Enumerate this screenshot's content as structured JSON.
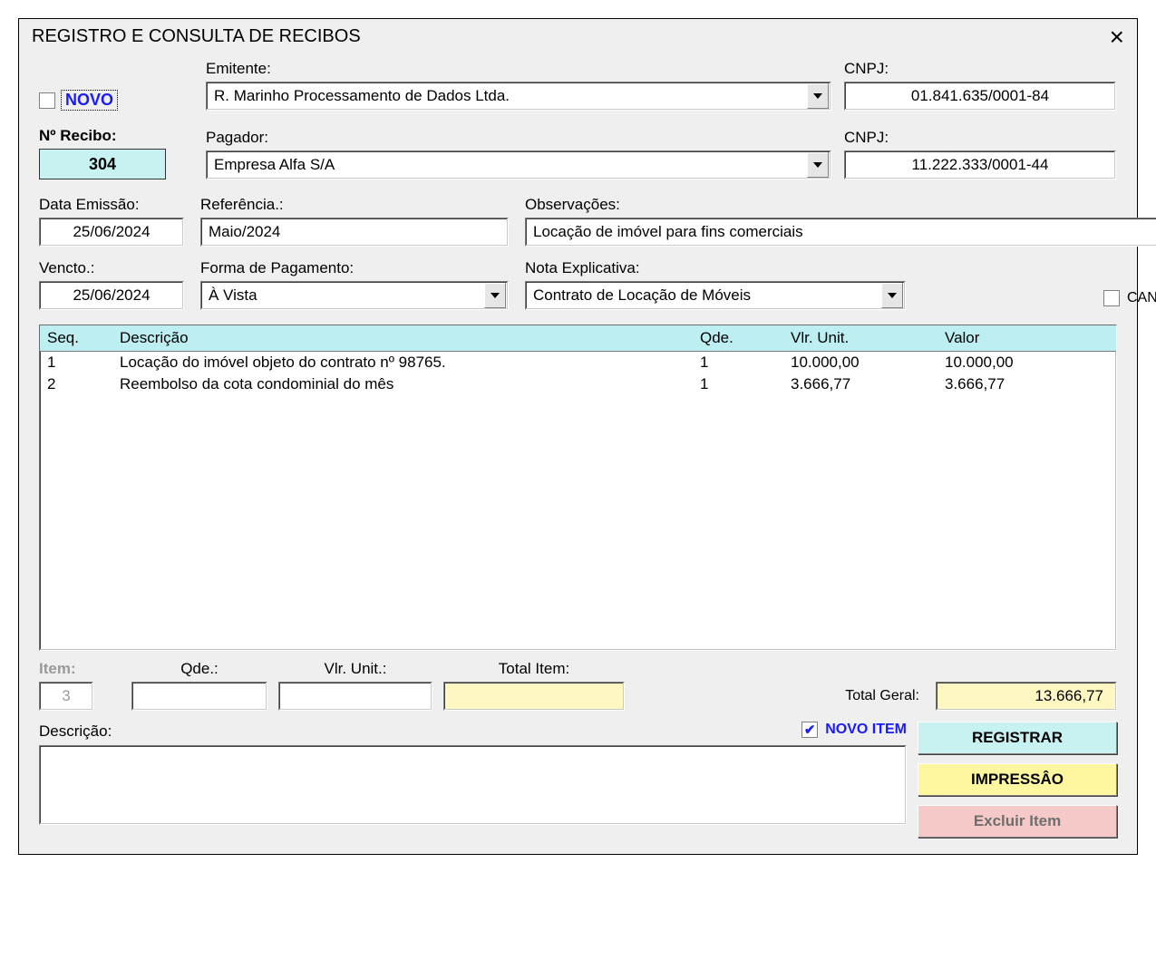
{
  "window": {
    "title": "REGISTRO E CONSULTA DE RECIBOS"
  },
  "novo_label": "NOVO",
  "labels": {
    "emitente": "Emitente:",
    "cnpj": "CNPJ:",
    "num_recibo": "Nº Recibo:",
    "pagador": "Pagador:",
    "data_emissao": "Data Emissão:",
    "referencia": "Referência.:",
    "observacoes": "Observações:",
    "vencto": "Vencto.:",
    "forma_pag": "Forma de Pagamento:",
    "nota_exp": "Nota Explicativa:",
    "cancelado": "CANCELADO",
    "item": "Item:",
    "qde": "Qde.:",
    "vlr_unit": "Vlr. Unit.:",
    "total_item": "Total Item:",
    "total_geral": "Total Geral:",
    "novo_item": "NOVO ITEM",
    "descricao": "Descrição:",
    "registrar": "REGISTRAR",
    "impressao": "IMPRESSÂO",
    "excluir": "Excluir Item"
  },
  "fields": {
    "emitente": "R. Marinho Processamento de Dados Ltda.",
    "emitente_cnpj": "01.841.635/0001-84",
    "pagador": "Empresa Alfa S/A",
    "pagador_cnpj": "11.222.333/0001-44",
    "num_recibo": "304",
    "data_emissao": "25/06/2024",
    "referencia": "Maio/2024",
    "observacoes": "Locação de imóvel para fins comerciais",
    "vencto": "25/06/2024",
    "forma_pag": "À Vista",
    "nota_exp": "Contrato de Locação de Móveis",
    "total_geral": "13.666,77",
    "next_item": "3"
  },
  "table": {
    "headers": {
      "seq": "Seq.",
      "desc": "Descrição",
      "qde": "Qde.",
      "unit": "Vlr. Unit.",
      "valor": "Valor"
    },
    "rows": [
      {
        "seq": "1",
        "desc": "Locação do imóvel objeto do contrato nº 98765.",
        "qde": "1",
        "unit": "10.000,00",
        "valor": "10.000,00"
      },
      {
        "seq": "2",
        "desc": "Reembolso da cota condominial do mês",
        "qde": "1",
        "unit": "3.666,77",
        "valor": "3.666,77"
      }
    ]
  },
  "checks": {
    "novo": false,
    "cancelado": false,
    "novo_item": true
  }
}
